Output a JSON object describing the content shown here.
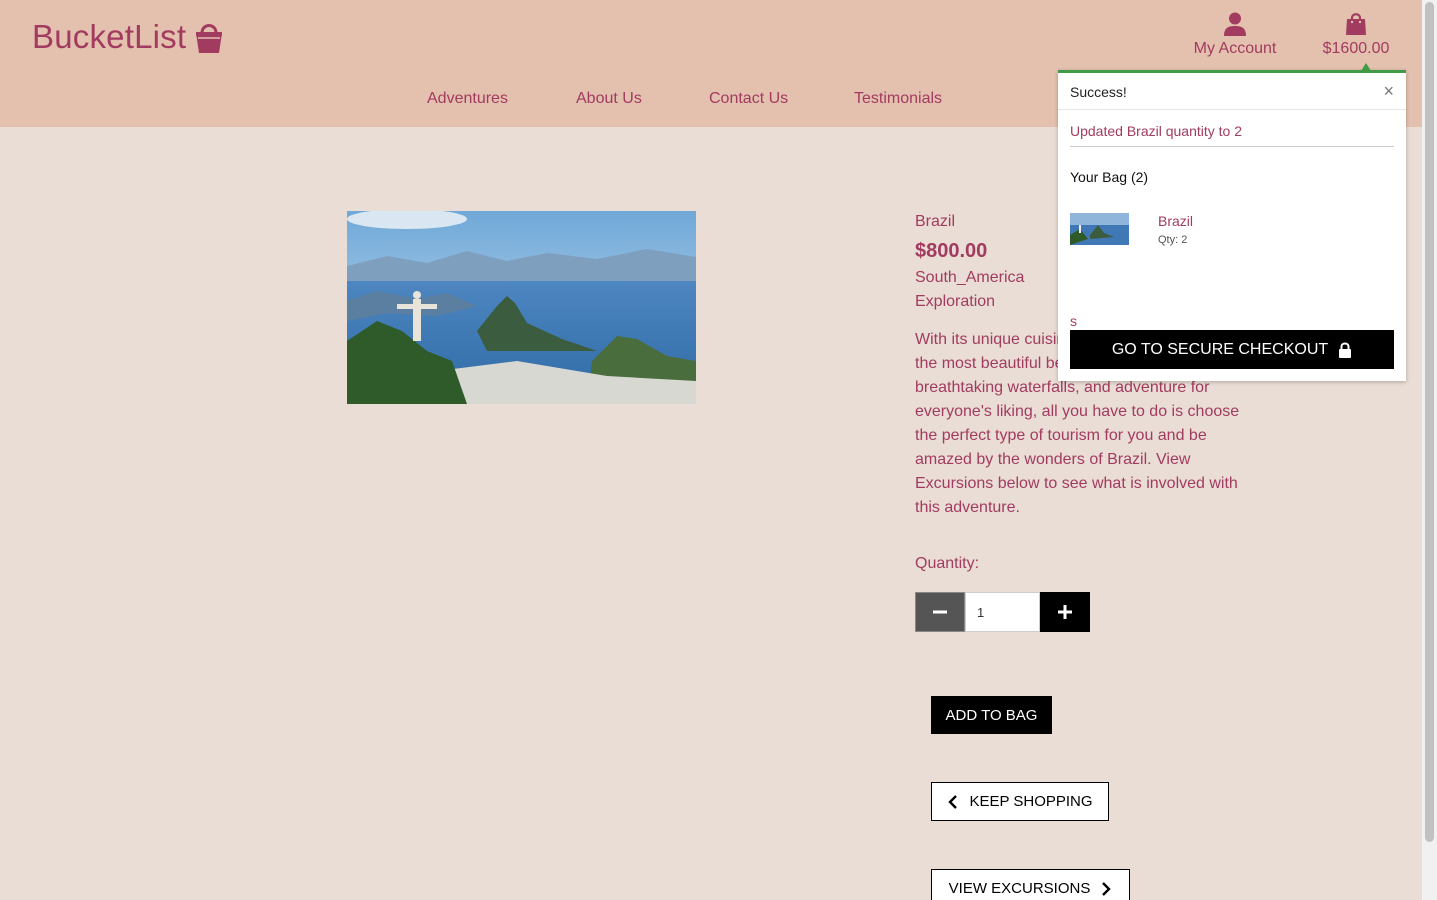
{
  "header": {
    "logo_text": "BucketList",
    "logo_icon": "basket-icon",
    "account_label": "My Account",
    "account_icon": "user-icon",
    "bag_total": "$1600.00",
    "bag_icon": "shopping-bag-icon",
    "nav": [
      "Adventures",
      "About Us",
      "Contact Us",
      "Testimonials"
    ]
  },
  "product": {
    "name": "Brazil",
    "price": "$800.00",
    "region": "South_America",
    "category": "Exploration",
    "description": "With its unique cuisine, vibrant culture, some of the most beautiful beaches in the world, breathtaking waterfalls, and adventure for everyone's liking, all you have to do is choose the perfect type of tourism for you and be amazed by the wonders of Brazil. View Excursions below to see what is involved with this adventure.",
    "quantity_label": "Quantity:",
    "quantity_value": "1",
    "add_to_bag": "ADD TO BAG",
    "keep_shopping": "KEEP SHOPPING",
    "view_excursions": "VIEW EXCURSIONS"
  },
  "toast": {
    "title": "Success!",
    "close": "×",
    "message": "Updated Brazil quantity to 2",
    "bag_title": "Your Bag (2)",
    "item_name": "Brazil",
    "item_qty": "Qty: 2",
    "stray": "s",
    "checkout": "GO TO SECURE CHECKOUT"
  },
  "colors": {
    "brand": "#a23b60",
    "header_bg": "#e4c0af",
    "page_bg": "#e9ddd5",
    "success": "#3f9b45"
  }
}
